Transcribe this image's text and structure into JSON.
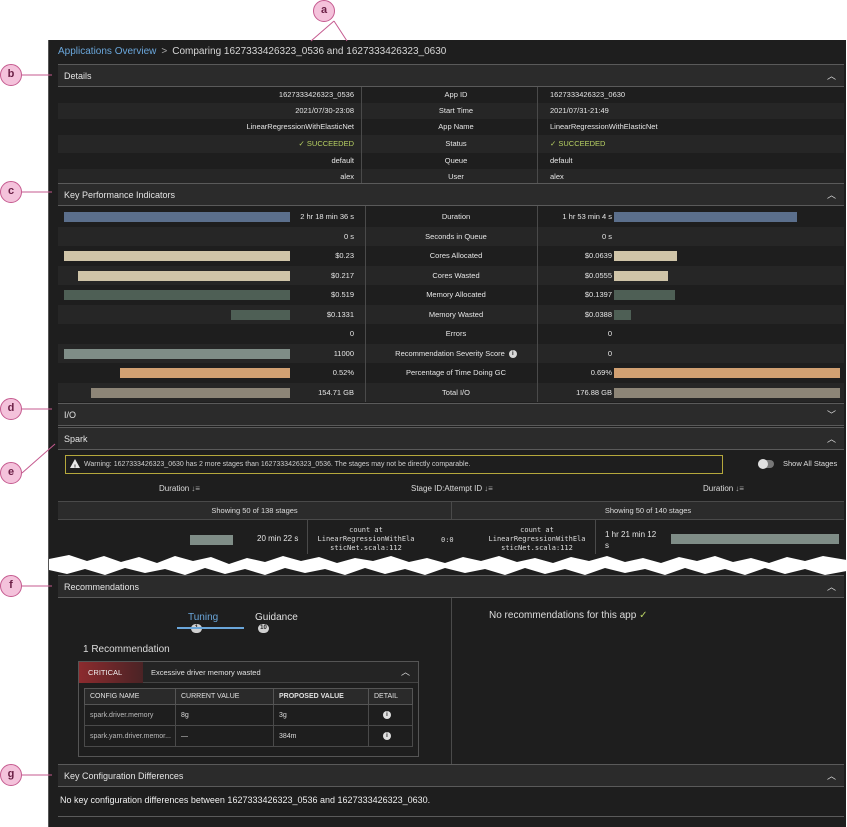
{
  "breadcrumb": {
    "link": "Applications Overview",
    "separator": ">",
    "current": "Comparing 1627333426323_0536 and 1627333426323_0630"
  },
  "sections": {
    "details": "Details",
    "kpi": "Key Performance Indicators",
    "io": "I/O",
    "spark": "Spark",
    "recommendations": "Recommendations",
    "config_diff": "Key Configuration Differences"
  },
  "details": {
    "rows": [
      {
        "left": "1627333426323_0536",
        "label": "App ID",
        "right": "1627333426323_0630"
      },
      {
        "left": "2021/07/30-23:08",
        "label": "Start Time",
        "right": "2021/07/31-21:49"
      },
      {
        "left": "LinearRegressionWithElasticNet",
        "label": "App Name",
        "right": "LinearRegressionWithElasticNet"
      },
      {
        "left": "SUCCEEDED",
        "label": "Status",
        "right": "SUCCEEDED"
      },
      {
        "left": "default",
        "label": "Queue",
        "right": "default"
      },
      {
        "left": "alex",
        "label": "User",
        "right": "alex"
      }
    ]
  },
  "kpi": {
    "rows": [
      {
        "left": "2 hr 18 min 36 s",
        "label": "Duration",
        "right": "1 hr 53 min 4 s",
        "left_frac": 1.0,
        "right_frac": 0.81,
        "color": "#5b6f8c"
      },
      {
        "left": "0 s",
        "label": "Seconds in Queue",
        "right": "0 s",
        "left_frac": 0,
        "right_frac": 0,
        "color": "#5b6f8c"
      },
      {
        "left": "$0.23",
        "label": "Cores Allocated",
        "right": "$0.0639",
        "left_frac": 1.0,
        "right_frac": 0.28,
        "color": "#cfc4a8"
      },
      {
        "left": "$0.217",
        "label": "Cores Wasted",
        "right": "$0.0555",
        "left_frac": 0.94,
        "right_frac": 0.24,
        "color": "#cfc4a8"
      },
      {
        "left": "$0.519",
        "label": "Memory Allocated",
        "right": "$0.1397",
        "left_frac": 1.0,
        "right_frac": 0.27,
        "color": "#4e5f55"
      },
      {
        "left": "$0.1331",
        "label": "Memory Wasted",
        "right": "$0.0388",
        "left_frac": 0.26,
        "right_frac": 0.075,
        "color": "#4e5f55"
      },
      {
        "left": "0",
        "label": "Errors",
        "right": "0",
        "left_frac": 0,
        "right_frac": 0,
        "color": "#5b6f8c"
      },
      {
        "left": "11000",
        "label": "Recommendation Severity Score",
        "right": "0",
        "left_frac": 1.0,
        "right_frac": 0,
        "color": "#7f8d87",
        "info": true
      },
      {
        "left": "0.52%",
        "label": "Percentage of Time Doing GC",
        "right": "0.69%",
        "left_frac": 0.75,
        "right_frac": 1.0,
        "color": "#d1a072"
      },
      {
        "left": "154.71 GB",
        "label": "Total I/O",
        "right": "176.88 GB",
        "left_frac": 0.88,
        "right_frac": 1.0,
        "color": "#8d8577"
      }
    ]
  },
  "spark": {
    "warning": "Warning: 1627333426323_0630 has 2 more stages than 1627333426323_0536. The stages may not be directly comparable.",
    "show_all_label": "Show All Stages",
    "col_duration_left": "Duration",
    "col_stage": "Stage ID:Attempt ID",
    "col_duration_right": "Duration",
    "showing_left": "Showing 50 of 138 stages",
    "showing_right": "Showing 50 of 140 stages",
    "stage_row": {
      "left_duration": "20 min 22 s",
      "left_desc_1": "count at",
      "left_desc_2": "LinearRegressionWithEla",
      "left_desc_3": "sticNet.scala:112",
      "stage_id": "0:0",
      "right_desc_1": "count at",
      "right_desc_2": "LinearRegressionWithEla",
      "right_desc_3": "sticNet.scala:112",
      "right_duration_1": "1 hr 21 min 12",
      "right_duration_2": "s"
    }
  },
  "recommendations": {
    "tab_tuning": "Tuning",
    "tab_tuning_count": "1",
    "tab_guidance": "Guidance",
    "tab_guidance_count": "10",
    "count_text": "1 Recommendation",
    "severity": "CRITICAL",
    "title": "Excessive driver memory wasted",
    "headers": [
      "CONFIG NAME",
      "CURRENT VALUE",
      "PROPOSED VALUE",
      "DETAIL"
    ],
    "rows": [
      {
        "config": "spark.driver.memory",
        "current": "8g",
        "proposed": "3g"
      },
      {
        "config": "spark.yarn.driver.memor...",
        "current": "—",
        "proposed": "384m"
      }
    ],
    "none_right": "No recommendations for this app"
  },
  "config_diff": {
    "message": "No key configuration differences between 1627333426323_0536 and 1627333426323_0630."
  },
  "callouts": [
    "a",
    "b",
    "c",
    "d",
    "e",
    "f",
    "g"
  ]
}
